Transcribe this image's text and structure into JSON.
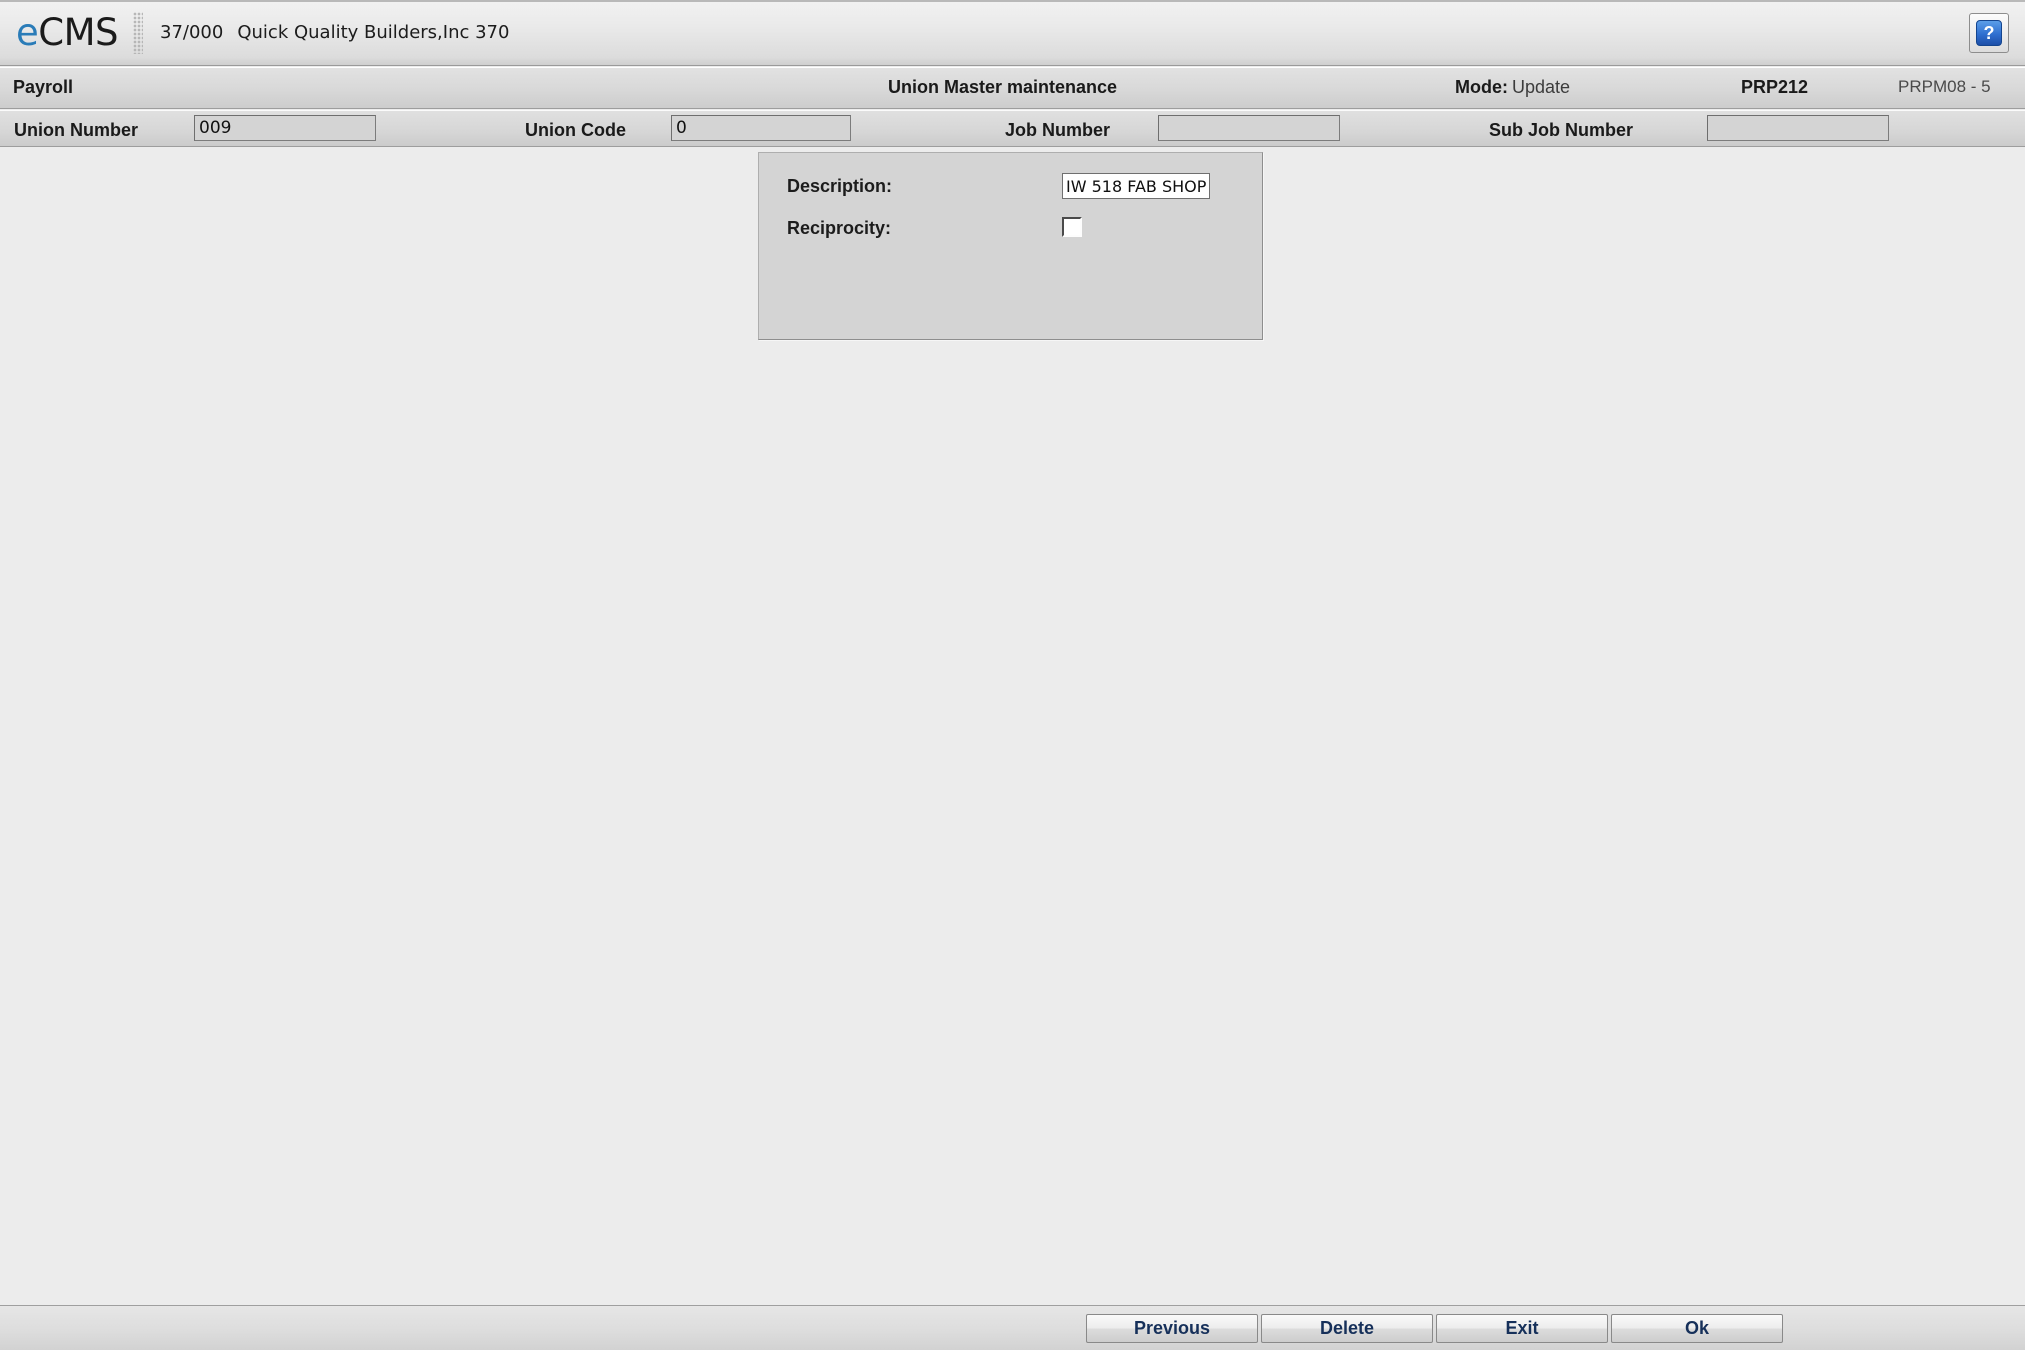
{
  "app": {
    "logo_e": "e",
    "logo_rest": "CMS",
    "company_number": "37/000",
    "company_name": "Quick Quality Builders,Inc 370",
    "help_glyph": "?",
    "accent_blue": "#2a7cb8",
    "help_button_blue": "#2f6fd0"
  },
  "module_bar": {
    "module_name": "Payroll",
    "screen_title": "Union Master maintenance",
    "mode_label": "Mode:",
    "mode_value": "Update",
    "program_id": "PRP212",
    "screen_id": "PRPM08 - 5"
  },
  "key_fields": [
    {
      "label": "Union Number",
      "value": "009"
    },
    {
      "label": "Union Code",
      "value": "0"
    },
    {
      "label": "Job Number",
      "value": ""
    },
    {
      "label": "Sub Job Number",
      "value": ""
    }
  ],
  "detail_panel": {
    "description": {
      "label": "Description:",
      "value": "IW 518 FAB SHOP"
    },
    "reciprocity": {
      "label": "Reciprocity:",
      "checked": false
    }
  },
  "actions": {
    "previous": "Previous",
    "delete": "Delete",
    "exit": "Exit",
    "ok": "Ok"
  }
}
